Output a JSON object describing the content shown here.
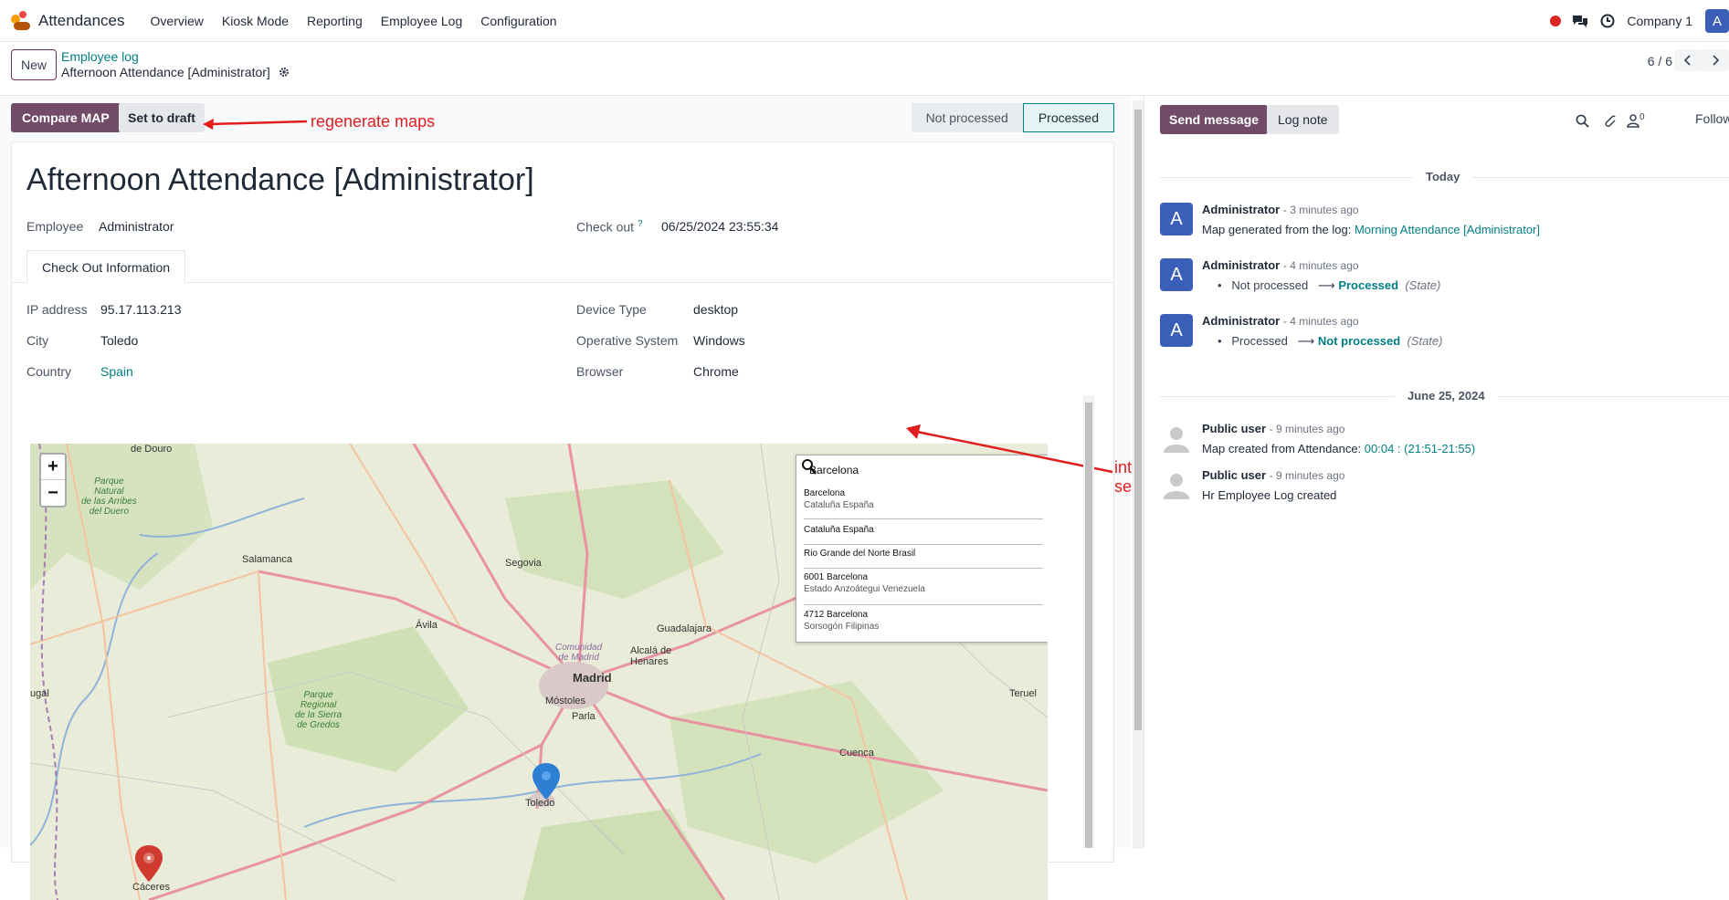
{
  "topnav": {
    "app_name": "Attendances",
    "menu": [
      "Overview",
      "Kiosk Mode",
      "Reporting",
      "Employee Log",
      "Configuration"
    ],
    "company": "Company 1",
    "avatar_letter": "A"
  },
  "control": {
    "new_label": "New",
    "breadcrumb": "Employee log",
    "record_name": "Afternoon Attendance [Administrator]",
    "pager": "6 / 6"
  },
  "form": {
    "compare_btn": "Compare MAP",
    "draft_btn": "Set to draft",
    "status_steps": [
      "Not processed",
      "Processed"
    ],
    "active_status": "Processed",
    "annot_regen": "regenerate maps",
    "annot_search": "interactive search",
    "title": "Afternoon Attendance [Administrator]",
    "employee_label": "Employee",
    "employee_value": "Administrator",
    "checkout_label": "Check out",
    "checkout_help": "?",
    "checkout_value": "06/25/2024 23:55:34",
    "tab_label": "Check Out Information",
    "ip_label": "IP address",
    "ip_value": "95.17.113.213",
    "city_label": "City",
    "city_value": "Toledo",
    "country_label": "Country",
    "country_value": "Spain",
    "device_label": "Device Type",
    "device_value": "desktop",
    "os_label": "Operative System",
    "os_value": "Windows",
    "browser_label": "Browser",
    "browser_value": "Chrome"
  },
  "map": {
    "zoom_in": "+",
    "zoom_out": "−",
    "search_value": "Barcelona",
    "suggestions": [
      {
        "name": "Barcelona",
        "sub": "Cataluña España"
      },
      {
        "name": "Cataluña España",
        "sub": ""
      },
      {
        "name": "Rio Grande del Norte Brasil",
        "sub": ""
      },
      {
        "name": "6001 Barcelona",
        "sub": "Estado Anzoátegui Venezuela"
      },
      {
        "name": "4712 Barcelona",
        "sub": "Sorsogón Filipinas"
      }
    ],
    "cities": {
      "douro": "de Douro",
      "salamanca": "Salamanca",
      "segovia": "Segovia",
      "avila": "Ávila",
      "guadalajara": "Guadalajara",
      "alcala": "Alcalá de\nHenares",
      "madrid": "Madrid",
      "mostoles": "Móstoles",
      "parla": "Parla",
      "cuenca": "Cuenca",
      "toledo": "Toledo",
      "caceres": "Cáceres",
      "teruel": "Teruel",
      "ugal": "ugal"
    },
    "parks": {
      "arribes": "Parque\nNatural\nde las Arribes\ndel Duero",
      "gredos": "Parque\nRegional\nde la Sierra\nde Gredos",
      "comunidad": "Comunidad\nde Madrid"
    }
  },
  "chatter": {
    "send_btn": "Send message",
    "log_btn": "Log note",
    "follower_count": "0",
    "follow_label": "Follow",
    "date_today": "Today",
    "date_june": "June 25, 2024",
    "messages": [
      {
        "author": "Administrator",
        "time": "- 3 minutes ago",
        "body": "Map generated from the log: ",
        "link": "Morning Attendance [Administrator]"
      },
      {
        "author": "Administrator",
        "time": "- 4 minutes ago",
        "old": "Not processed",
        "new": "Processed",
        "field": "(State)"
      },
      {
        "author": "Administrator",
        "time": "- 4 minutes ago",
        "old": "Processed",
        "new": "Not processed",
        "field": "(State)"
      },
      {
        "author": "Public user",
        "time": "- 9 minutes ago",
        "body": "Map created from Attendance: ",
        "link": "00:04 : (21:51-21:55)"
      },
      {
        "author": "Public user",
        "time": "- 9 minutes ago",
        "body": "Hr Employee Log created"
      }
    ]
  },
  "colors": {
    "primary": "#714b67",
    "link": "#017e84",
    "annotation": "#e11d1d"
  }
}
